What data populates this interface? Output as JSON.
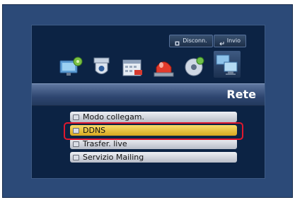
{
  "topbar": {
    "disconnect_label": "Disconn.",
    "invio_label": "Invio"
  },
  "menu_icons": [
    "camera-setup-icon",
    "ptz-camera-icon",
    "record-calendar-icon",
    "alarm-siren-icon",
    "disc-backup-icon",
    "network-icon"
  ],
  "header": {
    "title": "Rete"
  },
  "list": {
    "items": [
      {
        "label": "Modo collegam."
      },
      {
        "label": "DDNS"
      },
      {
        "label": "Trasfer. live"
      },
      {
        "label": "Servizio Mailing"
      }
    ]
  },
  "colors": {
    "selected": "#e6b93a",
    "highlight_outline": "#e0182e"
  }
}
